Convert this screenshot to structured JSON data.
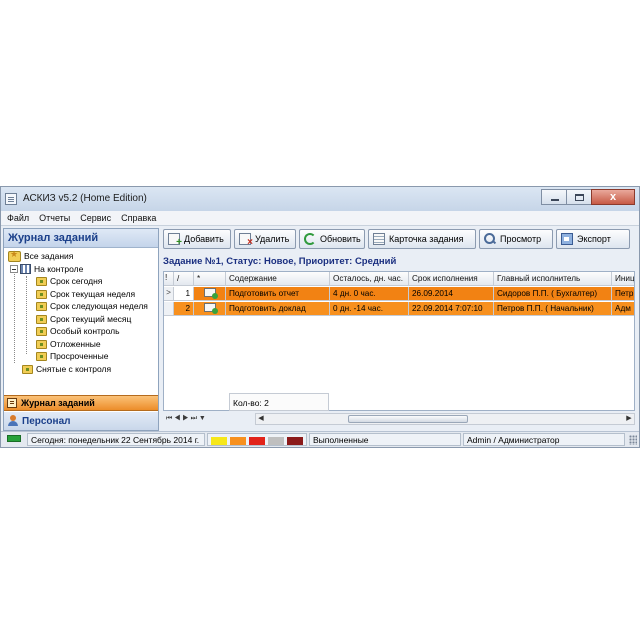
{
  "window": {
    "title": "АСКИЗ v5.2 (Home Edition)",
    "close_glyph": "x"
  },
  "menu": [
    "Файл",
    "Отчеты",
    "Сервис",
    "Справка"
  ],
  "left_panel": {
    "header": "Журнал заданий",
    "tree": {
      "all_tasks": "Все задания",
      "on_control": "На контроле",
      "children": [
        "Срок сегодня",
        "Срок текущая неделя",
        "Срок следующая неделя",
        "Срок текущий месяц",
        "Особый контроль",
        "Отложенные",
        "Просроченные"
      ],
      "removed": "Снятые с контроля"
    },
    "tabs": {
      "active": "Журнал заданий",
      "other": "Персонал"
    }
  },
  "toolbar": {
    "add": "Добавить",
    "delete": "Удалить",
    "refresh": "Обновить",
    "card": "Карточка задания",
    "view": "Просмотр",
    "export": "Экспорт"
  },
  "task_header": "Задание №1, Статус: Новое, Приоритет: Средний",
  "grid": {
    "indicator_header": "!",
    "num_header": "/",
    "icon_header": "*",
    "columns": [
      "Содержание",
      "Осталось, дн. час.",
      "Срок исполнения",
      "Главный исполнитель",
      "Иниц"
    ],
    "rows": [
      {
        "indicator": ">",
        "num": "1",
        "content": "Подготовить отчет",
        "remaining": "4 дн. 0 час.",
        "deadline": "26.09.2014",
        "executor": "Сидоров П.П. ( Бухгалтер)",
        "initiator": "Петр"
      },
      {
        "indicator": "",
        "num": "2",
        "content": "Подготовить доклад",
        "remaining": "0 дн. -14 час.",
        "deadline": "22.09.2014 7:07:10",
        "executor": "Петров П.П. ( Начальник)",
        "initiator": "Адм"
      }
    ],
    "count_label": "Кол-во: 2",
    "nav_glyphs": "⏮ ◀ ▶ ⏭ ▼",
    "scroll_left": "◀",
    "scroll_right": "▶"
  },
  "statusbar": {
    "today": "Сегодня: понедельник 22 Сентябрь 2014 г.",
    "legend_colors": [
      "#f6e71a",
      "#f7901e",
      "#e2231a",
      "#bfbfbf",
      "#8b1a1a"
    ],
    "legend_label": "Выполненные",
    "user": "Admin / Администратор"
  }
}
